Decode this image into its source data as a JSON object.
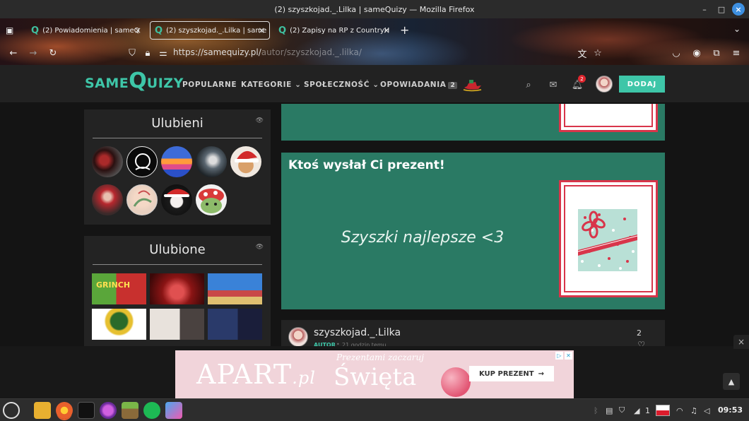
{
  "window": {
    "title": "(2) szyszkojad._.Lilka | sameQuizy — Mozilla Firefox",
    "controls": [
      "–",
      "□",
      "×"
    ]
  },
  "browser": {
    "tabs": [
      {
        "label": "(2) Powiadomienia | sameQ"
      },
      {
        "label": "(2) szyszkojad._.Lilka | same"
      },
      {
        "label": "(2) Zapisy na RP z CountryH"
      }
    ],
    "url_main": "https://samequizy.pl/",
    "url_rest": "autor/szyszkojad._.lilka/"
  },
  "site": {
    "logo": {
      "part1": "SAME",
      "big": "Q",
      "part2": "UIZY"
    },
    "menu": [
      {
        "label": "POPULARNE"
      },
      {
        "label": "KATEGORIE ⌄"
      },
      {
        "label": "SPOŁECZNOŚĆ ⌄"
      },
      {
        "label": "OPOWIADANIA",
        "badge": "2"
      }
    ],
    "notification_count": "2",
    "add_button": "DODAJ"
  },
  "sidebar": {
    "favorites_people_title": "Ulubieni",
    "favorites_items_title": "Ulubione",
    "thumb_text_grinch": "GRINCH"
  },
  "gift": {
    "heading": "Ktoś wysłał Ci prezent!",
    "message": "Szyszki najlepsze <3"
  },
  "comment": {
    "author": "szyszkojad._.Lilka",
    "role": "AUTOR",
    "time": "21 godzin temu",
    "likes": "2"
  },
  "ad": {
    "brand": "APART",
    "brand_suffix": ".pl",
    "subtitle": "Prezentami zaczaruj",
    "headline": "Święta",
    "cta": "KUP PREZENT",
    "cta_arrow": "→"
  },
  "taskbar": {
    "clock": "09:53",
    "workspace": "1"
  },
  "colors": {
    "brand": "#3ec6a8",
    "gift_green": "#2a7a64",
    "gift_red": "#d8354a"
  }
}
